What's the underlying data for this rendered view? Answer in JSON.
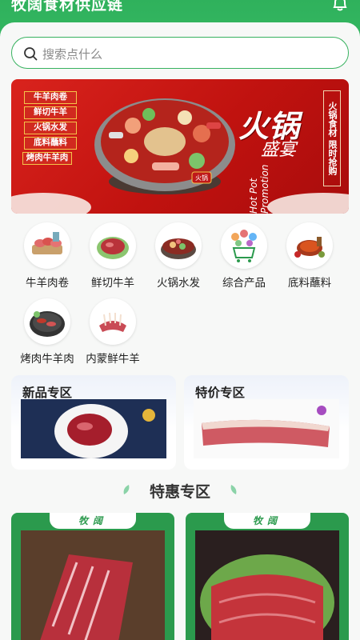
{
  "header": {
    "title": "牧阔食材供应链",
    "bell_icon": "bell-icon"
  },
  "search": {
    "placeholder": "搜索点什么",
    "icon": "search-icon"
  },
  "banner": {
    "tags": [
      "牛羊肉卷",
      "鲜切牛羊",
      "火锅水发",
      "底料蘸料",
      "烤肉牛羊肉"
    ],
    "title": "火锅",
    "subtitle": "盛宴",
    "english": "Hot Pot Promotion",
    "vertical_text": "火锅食材 限时抢购",
    "pot_badge": "火锅"
  },
  "categories": [
    {
      "label": "牛羊肉卷",
      "icon": "meat-roll-icon"
    },
    {
      "label": "鲜切牛羊",
      "icon": "fresh-meat-icon"
    },
    {
      "label": "火锅水发",
      "icon": "hotpot-icon"
    },
    {
      "label": "综合产品",
      "icon": "cart-icon"
    },
    {
      "label": "底料蘸料",
      "icon": "sauce-icon"
    },
    {
      "label": "烤肉牛羊肉",
      "icon": "bbq-icon"
    },
    {
      "label": "内蒙鲜牛羊",
      "icon": "lamb-rack-icon"
    }
  ],
  "zones": [
    {
      "title": "新品专区"
    },
    {
      "title": "特价专区"
    }
  ],
  "section": {
    "title": "特惠专区"
  },
  "products": [
    {
      "brand": "牧阔"
    },
    {
      "brand": "牧阔"
    }
  ],
  "colors": {
    "brand_green": "#37b25f",
    "banner_red": "#d1291f"
  }
}
